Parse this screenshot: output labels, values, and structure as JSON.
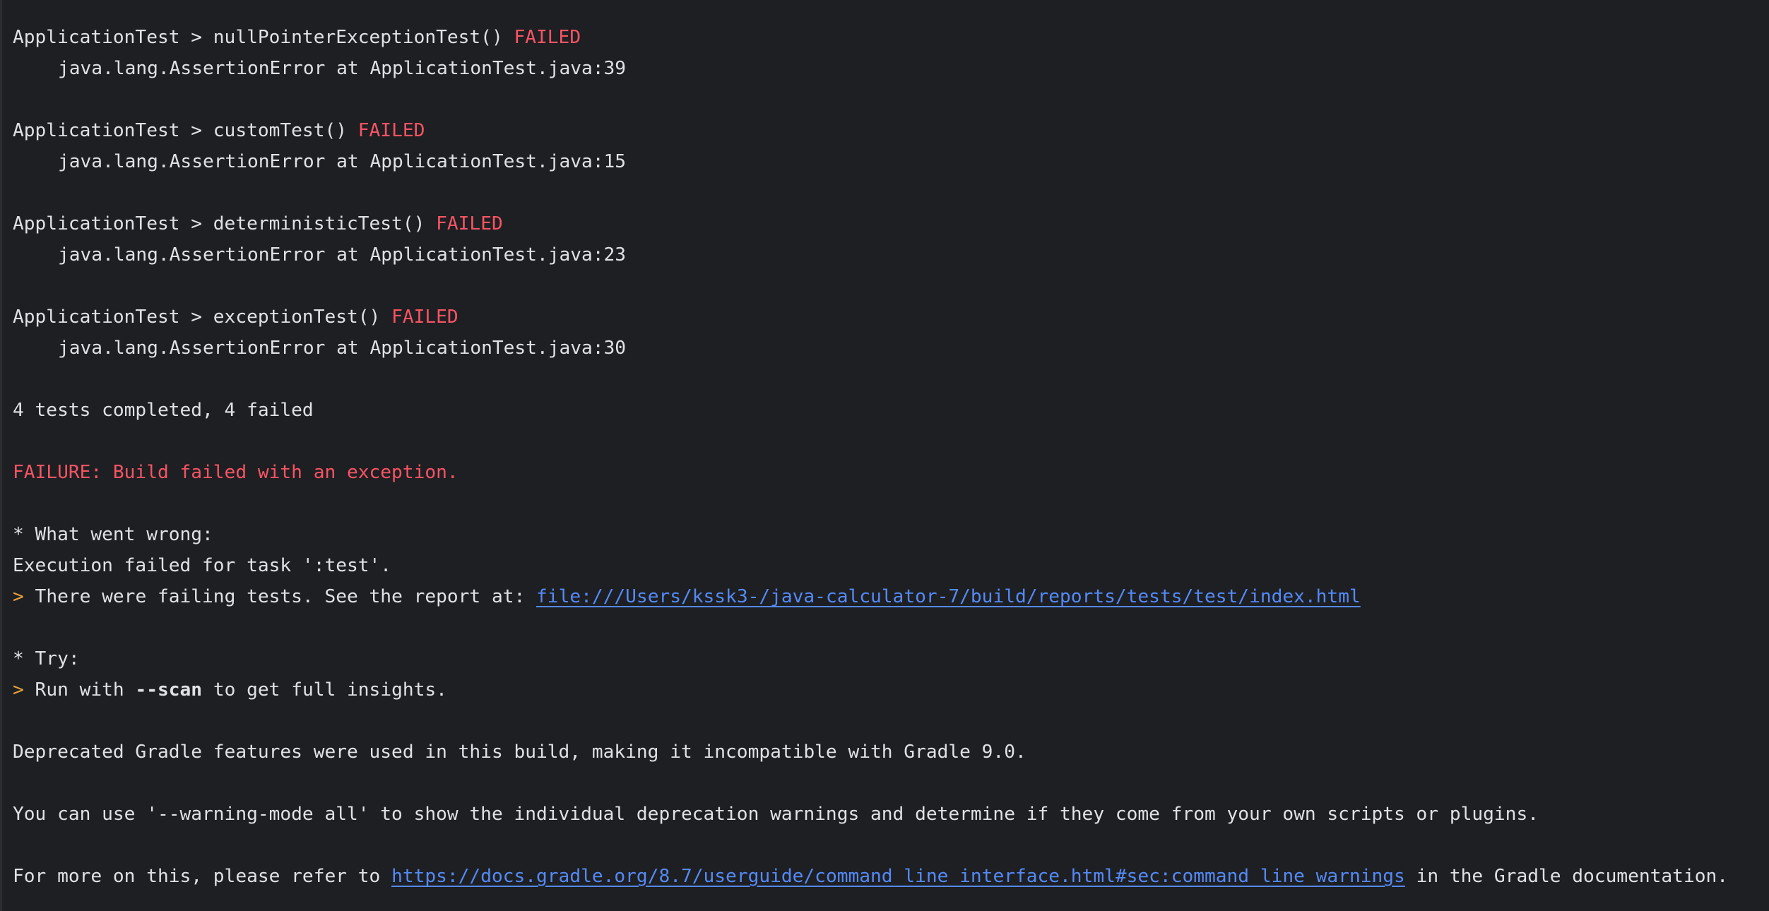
{
  "tests": [
    {
      "prefix": "ApplicationTest > nullPointerExceptionTest() ",
      "status": "FAILED",
      "error": "java.lang.AssertionError at ApplicationTest.java:39"
    },
    {
      "prefix": "ApplicationTest > customTest() ",
      "status": "FAILED",
      "error": "java.lang.AssertionError at ApplicationTest.java:15"
    },
    {
      "prefix": "ApplicationTest > deterministicTest() ",
      "status": "FAILED",
      "error": "java.lang.AssertionError at ApplicationTest.java:23"
    },
    {
      "prefix": "ApplicationTest > exceptionTest() ",
      "status": "FAILED",
      "error": "java.lang.AssertionError at ApplicationTest.java:30"
    }
  ],
  "summary": "4 tests completed, 4 failed",
  "failure": "FAILURE: Build failed with an exception.",
  "wrong": {
    "heading": "* What went wrong:",
    "detail": "Execution failed for task ':test'.",
    "prompt": "> ",
    "report_text": "There were failing tests. See the report at: ",
    "report_link": "file:///Users/kssk3-/java-calculator-7/build/reports/tests/test/index.html"
  },
  "try": {
    "heading": "* Try:",
    "prompt": "> ",
    "run_before": "Run with ",
    "run_flag": "--scan",
    "run_after": " to get full insights."
  },
  "deprecated": "Deprecated Gradle features were used in this build, making it incompatible with Gradle 9.0.",
  "warning_mode": "You can use '--warning-mode all' to show the individual deprecation warnings and determine if they come from your own scripts or plugins.",
  "refer": {
    "before": "For more on this, please refer to ",
    "link": "https://docs.gradle.org/8.7/userguide/command_line_interface.html#sec:command_line_warnings",
    "after": " in the Gradle documentation."
  },
  "colors": {
    "background": "#1e1f22",
    "text": "#dfe1e5",
    "failed": "#f75464",
    "prompt": "#e8a33d",
    "link": "#548af7"
  }
}
